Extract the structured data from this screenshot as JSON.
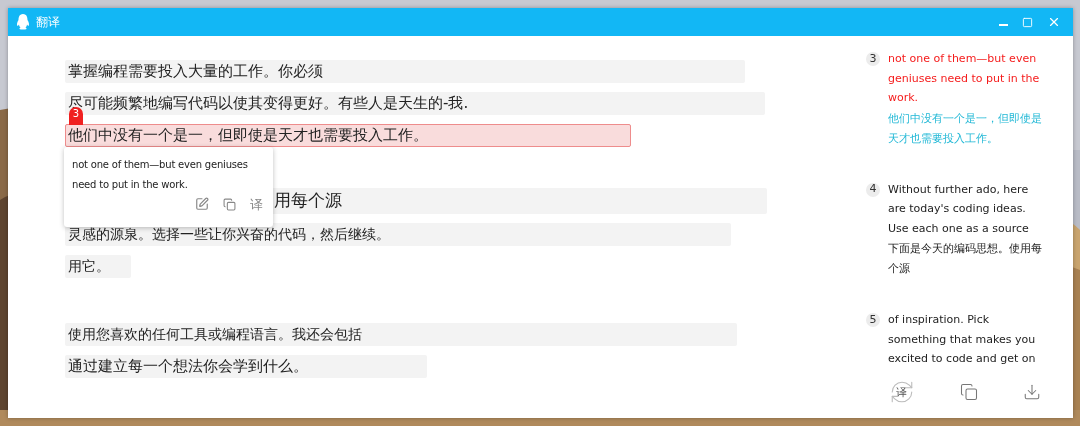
{
  "window": {
    "title": "翻译"
  },
  "paragraphs": [
    [
      {
        "text": "掌握编程需要投入大量的工作。你必须",
        "selected": false
      },
      {
        "text": "尽可能频繁地编写代码以使其变得更好。有些人是天生的-我.",
        "selected": false
      },
      {
        "text": "他们中没有一个是一，但即使是天才也需要投入工作。",
        "selected": true,
        "badge": "3"
      },
      {
        "text": "用每个源",
        "selected": false
      },
      {
        "text": "灵感的源泉。选择一些让你兴奋的代码，然后继续。",
        "selected": false
      },
      {
        "text": "用它。",
        "selected": false
      }
    ],
    [
      {
        "text": "使用您喜欢的任何工具或编程语言。我还会包括",
        "selected": false
      },
      {
        "text": "通过建立每一个想法你会学到什么。",
        "selected": false
      }
    ]
  ],
  "popup": {
    "text": "not one of them—but even geniuses need to put in the work.",
    "translate_label": "译"
  },
  "side_items": [
    {
      "number": "3",
      "source": "not one of them—but even geniuses need to put in the work.",
      "translation": "他们中没有一个是一，但即使是天才也需要投入工作。",
      "selected": true
    },
    {
      "number": "4",
      "source": "Without further ado, here are today's coding ideas. Use each one as a source",
      "translation": "下面是今天的编码思想。使用每个源",
      "selected": false
    },
    {
      "number": "5",
      "source": "of inspiration. Pick something that makes you excited to code and get on",
      "selected": false
    }
  ],
  "footer": {
    "translate_label": "译"
  }
}
